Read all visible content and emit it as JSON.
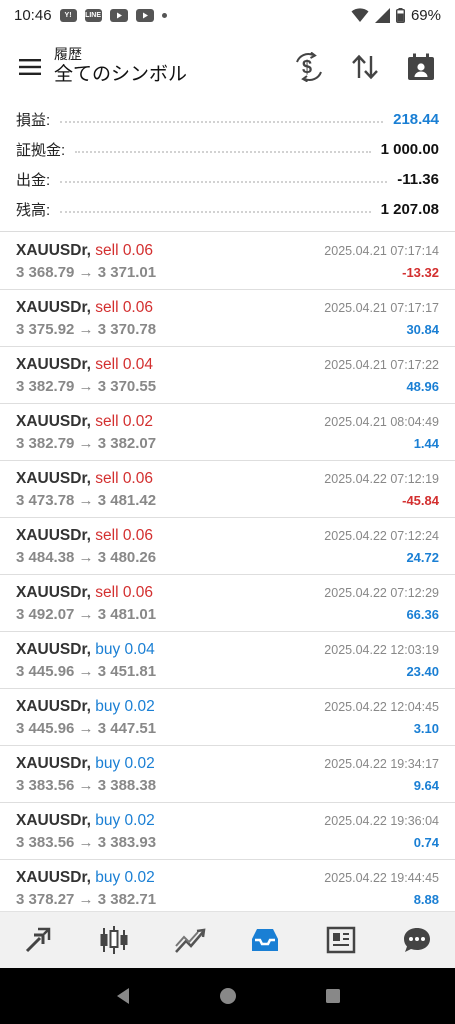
{
  "status_bar": {
    "time": "10:46",
    "yahoo_badge": "Y!",
    "line_badge": "LINE",
    "battery": "69%"
  },
  "header": {
    "subtitle": "履歴",
    "title": "全てのシンボル"
  },
  "summary": [
    {
      "label": "損益:",
      "value": "218.44",
      "highlight": true
    },
    {
      "label": "証拠金:",
      "value": "1 000.00",
      "highlight": false
    },
    {
      "label": "出金:",
      "value": "-11.36",
      "highlight": false
    },
    {
      "label": "残高:",
      "value": "1 207.08",
      "highlight": false
    }
  ],
  "deals": [
    {
      "symbol": "XAUUSDr,",
      "side": "sell",
      "side_text": "sell 0.06",
      "prices": "3 368.79 → 3 371.01",
      "time": "2025.04.21 07:17:14",
      "profit": "-13.32"
    },
    {
      "symbol": "XAUUSDr,",
      "side": "sell",
      "side_text": "sell 0.06",
      "prices": "3 375.92 → 3 370.78",
      "time": "2025.04.21 07:17:17",
      "profit": "30.84"
    },
    {
      "symbol": "XAUUSDr,",
      "side": "sell",
      "side_text": "sell 0.04",
      "prices": "3 382.79 → 3 370.55",
      "time": "2025.04.21 07:17:22",
      "profit": "48.96"
    },
    {
      "symbol": "XAUUSDr,",
      "side": "sell",
      "side_text": "sell 0.02",
      "prices": "3 382.79 → 3 382.07",
      "time": "2025.04.21 08:04:49",
      "profit": "1.44"
    },
    {
      "symbol": "XAUUSDr,",
      "side": "sell",
      "side_text": "sell 0.06",
      "prices": "3 473.78 → 3 481.42",
      "time": "2025.04.22 07:12:19",
      "profit": "-45.84"
    },
    {
      "symbol": "XAUUSDr,",
      "side": "sell",
      "side_text": "sell 0.06",
      "prices": "3 484.38 → 3 480.26",
      "time": "2025.04.22 07:12:24",
      "profit": "24.72"
    },
    {
      "symbol": "XAUUSDr,",
      "side": "sell",
      "side_text": "sell 0.06",
      "prices": "3 492.07 → 3 481.01",
      "time": "2025.04.22 07:12:29",
      "profit": "66.36"
    },
    {
      "symbol": "XAUUSDr,",
      "side": "buy",
      "side_text": "buy 0.04",
      "prices": "3 445.96 → 3 451.81",
      "time": "2025.04.22 12:03:19",
      "profit": "23.40"
    },
    {
      "symbol": "XAUUSDr,",
      "side": "buy",
      "side_text": "buy 0.02",
      "prices": "3 445.96 → 3 447.51",
      "time": "2025.04.22 12:04:45",
      "profit": "3.10"
    },
    {
      "symbol": "XAUUSDr,",
      "side": "buy",
      "side_text": "buy 0.02",
      "prices": "3 383.56 → 3 388.38",
      "time": "2025.04.22 19:34:17",
      "profit": "9.64"
    },
    {
      "symbol": "XAUUSDr,",
      "side": "buy",
      "side_text": "buy 0.02",
      "prices": "3 383.56 → 3 383.93",
      "time": "2025.04.22 19:36:04",
      "profit": "0.74"
    },
    {
      "symbol": "XAUUSDr,",
      "side": "buy",
      "side_text": "buy 0.02",
      "prices": "3 378.27 → 3 382.71",
      "time": "2025.04.22 19:44:45",
      "profit": "8.88"
    }
  ],
  "tabs": [
    {
      "name": "quotes-tab",
      "icon": "arrows-icon",
      "active": false
    },
    {
      "name": "chart-tab",
      "icon": "candlestick-icon",
      "active": false
    },
    {
      "name": "trade-tab",
      "icon": "trend-icon",
      "active": false
    },
    {
      "name": "history-tab",
      "icon": "inbox-icon",
      "active": true
    },
    {
      "name": "news-tab",
      "icon": "newspaper-icon",
      "active": false
    },
    {
      "name": "messages-tab",
      "icon": "chat-icon",
      "active": false
    }
  ],
  "colors": {
    "accent": "#1a7fd4",
    "sell": "#d32f2f",
    "buy": "#1a7fd4",
    "loss": "#d32f2f",
    "gain": "#1a7fd4"
  }
}
